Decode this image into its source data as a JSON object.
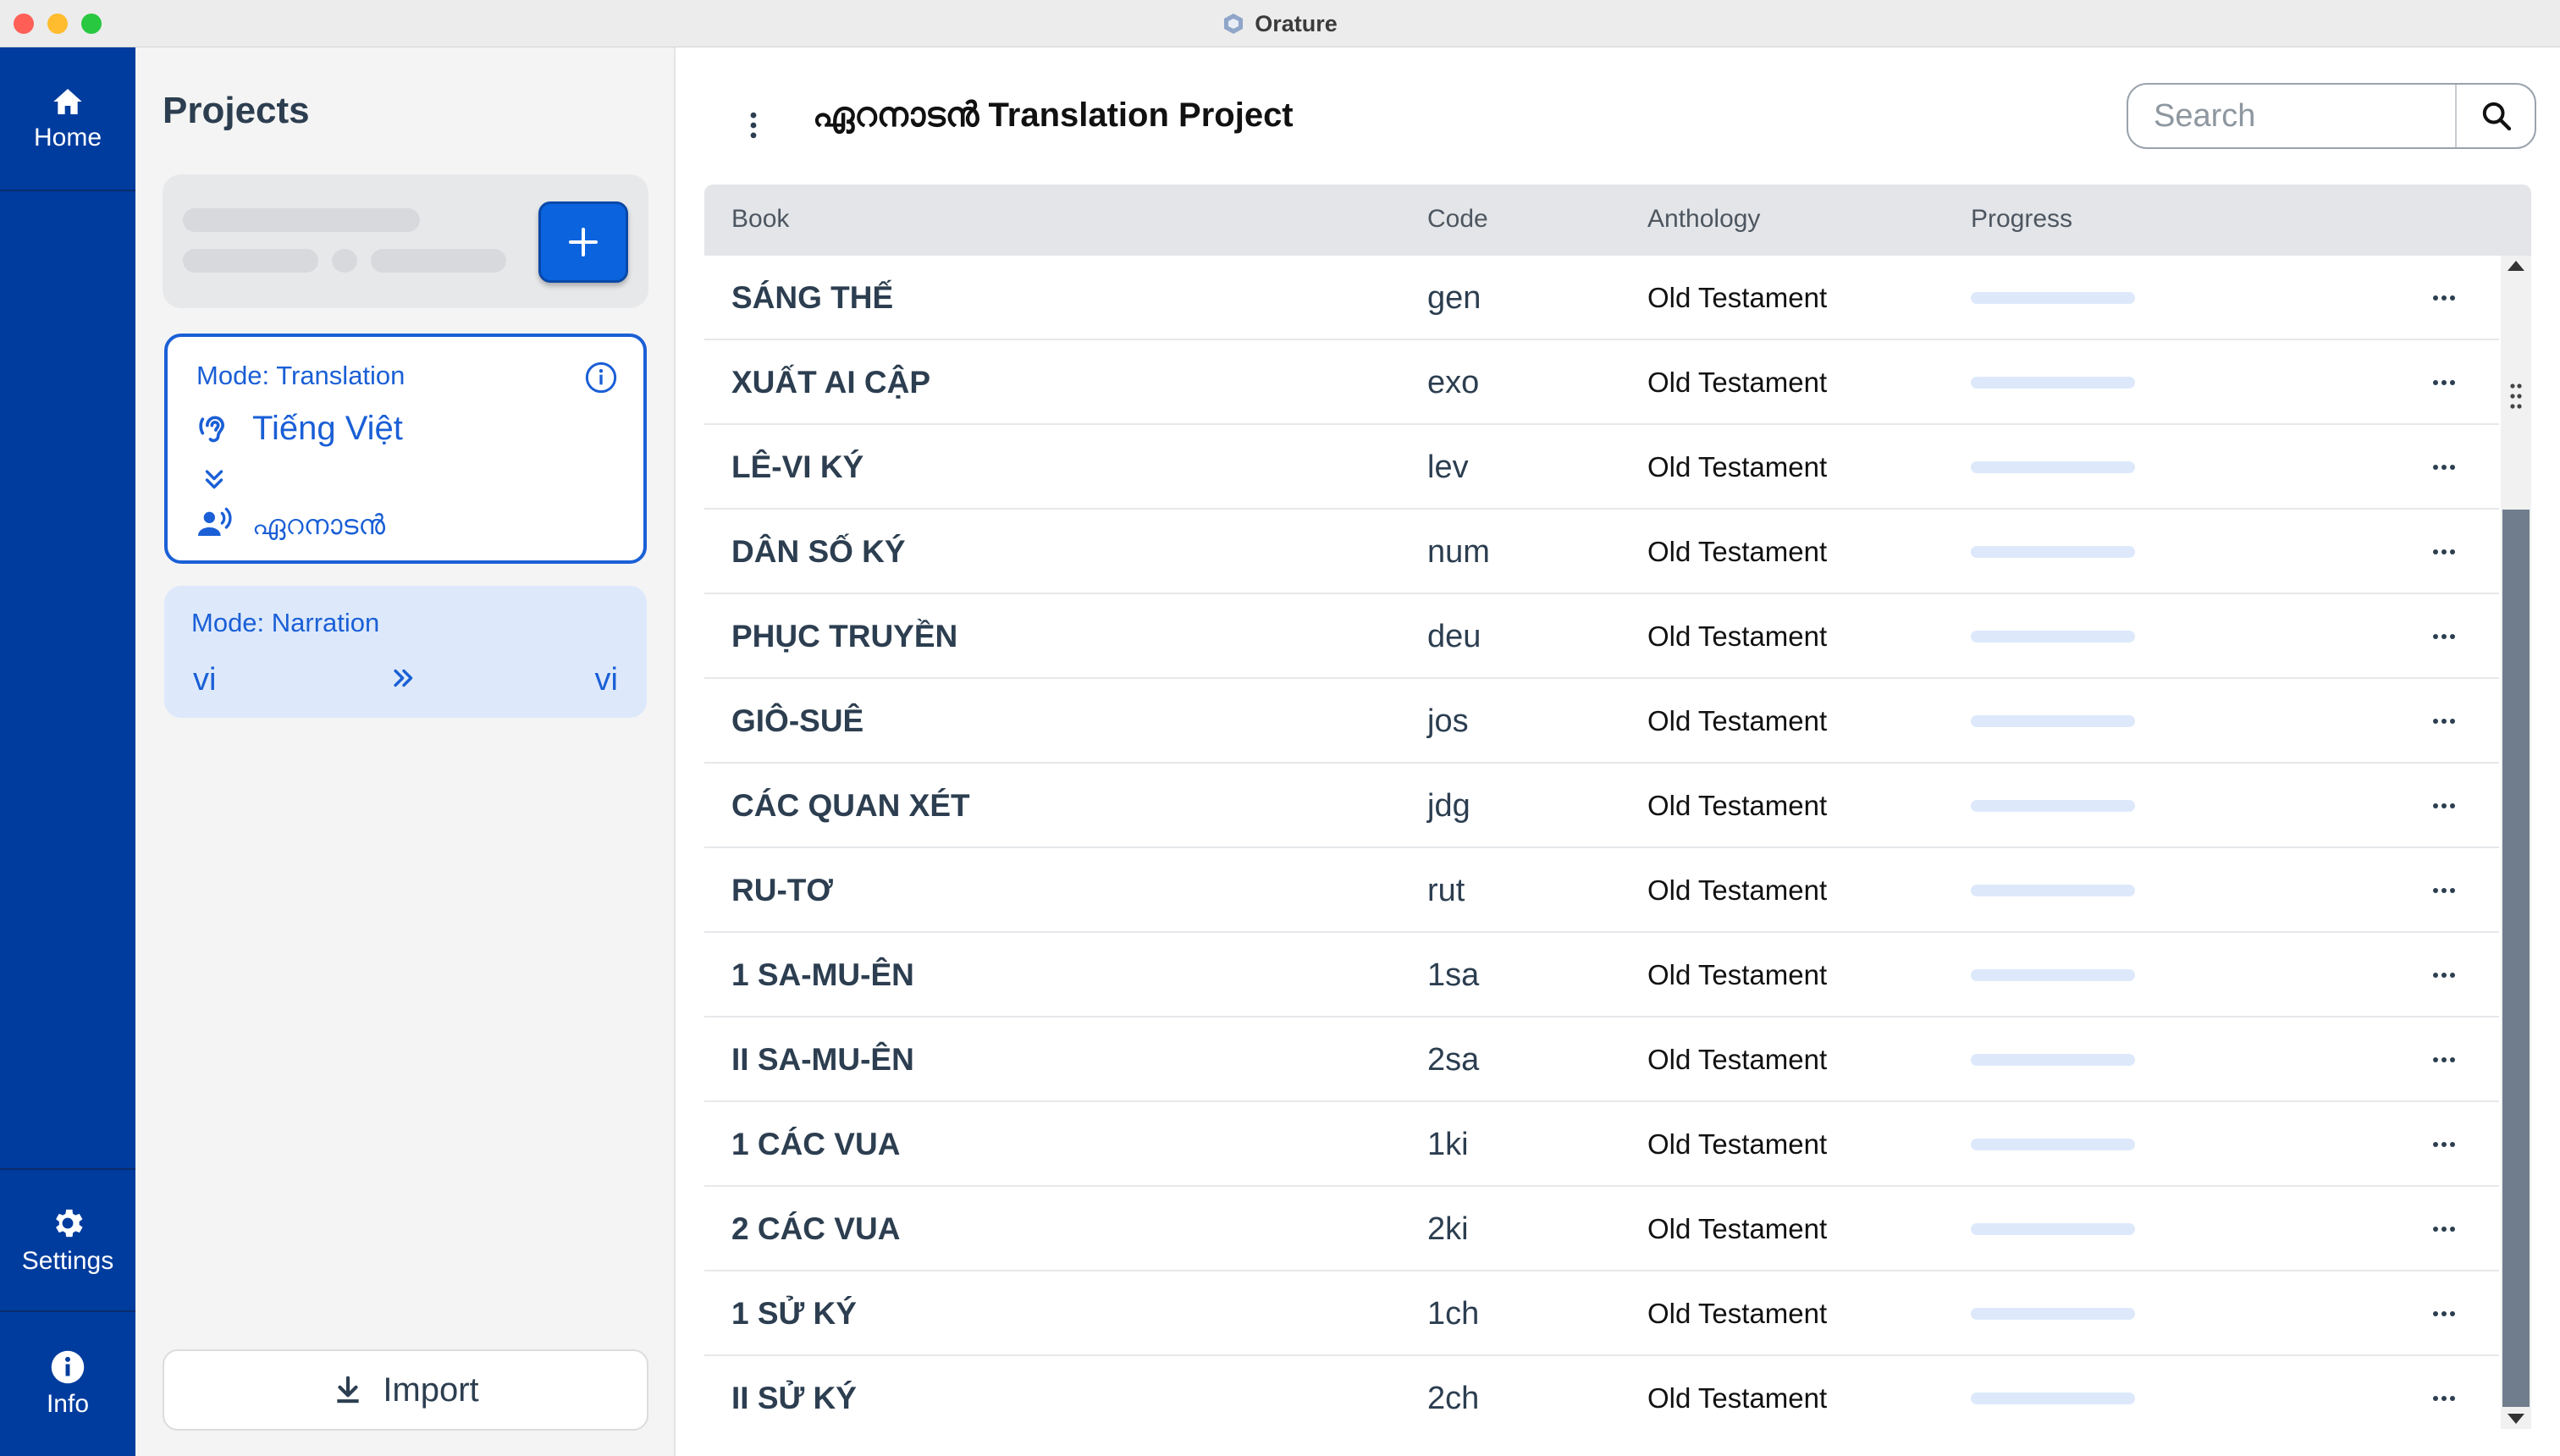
{
  "window": {
    "title": "Orature"
  },
  "nav": {
    "home": "Home",
    "settings": "Settings",
    "info": "Info"
  },
  "projects": {
    "title": "Projects",
    "active_card": {
      "mode": "Mode: Translation",
      "source_language": "Tiếng Việt",
      "target_language": "ഏറനാടൻ"
    },
    "narration_card": {
      "mode": "Mode: Narration",
      "source_language": "vi",
      "target_language": "vi"
    },
    "import_label": "Import"
  },
  "main": {
    "project_name": "ഏറനാടൻ",
    "project_suffix": "Translation Project",
    "search_placeholder": "Search",
    "columns": {
      "book": "Book",
      "code": "Code",
      "anthology": "Anthology",
      "progress": "Progress"
    },
    "books": [
      {
        "name": "SÁNG THẾ",
        "code": "gen",
        "anthology": "Old Testament",
        "progress": 0
      },
      {
        "name": "XUẤT AI CẬP",
        "code": "exo",
        "anthology": "Old Testament",
        "progress": 0
      },
      {
        "name": "LÊ-VI KÝ",
        "code": "lev",
        "anthology": "Old Testament",
        "progress": 0
      },
      {
        "name": "DÂN SỐ KÝ",
        "code": "num",
        "anthology": "Old Testament",
        "progress": 0
      },
      {
        "name": "PHỤC TRUYỀN",
        "code": "deu",
        "anthology": "Old Testament",
        "progress": 0
      },
      {
        "name": "GIÔ-SUÊ",
        "code": "jos",
        "anthology": "Old Testament",
        "progress": 0
      },
      {
        "name": "CÁC QUAN XÉT",
        "code": "jdg",
        "anthology": "Old Testament",
        "progress": 0
      },
      {
        "name": "RU-TƠ",
        "code": "rut",
        "anthology": "Old Testament",
        "progress": 0
      },
      {
        "name": "1 SA-MU-ÊN",
        "code": "1sa",
        "anthology": "Old Testament",
        "progress": 0
      },
      {
        "name": "II SA-MU-ÊN",
        "code": "2sa",
        "anthology": "Old Testament",
        "progress": 0
      },
      {
        "name": "1 CÁC VUA",
        "code": "1ki",
        "anthology": "Old Testament",
        "progress": 0
      },
      {
        "name": "2 CÁC VUA",
        "code": "2ki",
        "anthology": "Old Testament",
        "progress": 0
      },
      {
        "name": "1 SỬ KÝ",
        "code": "1ch",
        "anthology": "Old Testament",
        "progress": 0
      },
      {
        "name": "II SỬ KÝ",
        "code": "2ch",
        "anthology": "Old Testament",
        "progress": 0
      }
    ]
  },
  "colors": {
    "nav_background": "#003c9e",
    "accent": "#1a5fd6",
    "progress_track": "#dde9fb"
  },
  "icons": {
    "home": "home-icon",
    "settings": "gear-icon",
    "info": "info-icon",
    "add": "plus-icon",
    "source_language": "ear-icon",
    "direction": "double-chevron-down-icon",
    "target_language": "speaker-person-icon",
    "narration_direction": "double-chevron-right-icon",
    "import": "download-icon",
    "menu": "vertical-dots-icon",
    "search": "search-icon",
    "row_menu": "horizontal-dots-icon"
  }
}
